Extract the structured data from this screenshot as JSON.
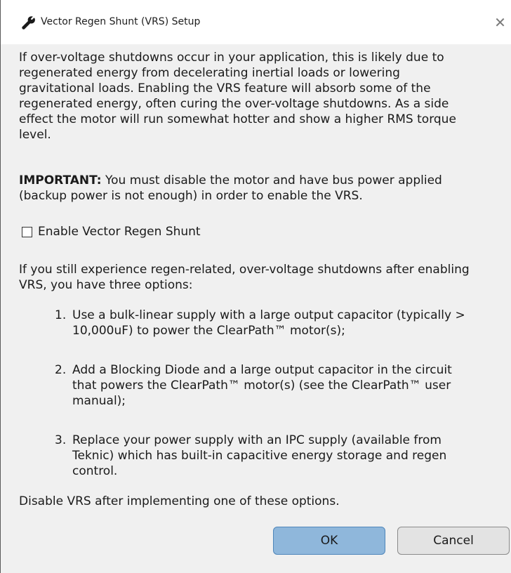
{
  "window": {
    "title": "Vector Regen Shunt (VRS) Setup",
    "title_icon": "wrench-icon",
    "close_glyph": "✕"
  },
  "body": {
    "intro": "If over-voltage shutdowns occur in your application, this is likely due to\nregenerated energy from decelerating inertial loads or lowering\ngravitational loads. Enabling the VRS feature will absorb some of the\nregenerated energy, often curing the over-voltage shutdowns. As a side\neffect the motor will run somewhat hotter and show a higher RMS torque\nlevel.",
    "important_label": "IMPORTANT:",
    "important_text": " You must disable the motor and have bus power applied\n(backup power is not enough) in order to enable the VRS.",
    "checkbox_label": "Enable Vector Regen Shunt",
    "checkbox_checked": false,
    "options_intro": "If you still experience regen-related, over-voltage shutdowns after enabling\nVRS, you have three options:",
    "options": [
      {
        "number": "1.",
        "text": "Use a bulk-linear supply with a large output capacitor (typically >\n10,000uF) to power the ClearPath™ motor(s);"
      },
      {
        "number": "2.",
        "text": "Add a Blocking Diode and a large output capacitor in the circuit\nthat powers the ClearPath™ motor(s) (see the ClearPath™ user\nmanual);"
      },
      {
        "number": "3.",
        "text": "Replace your power supply with an IPC supply (available from\nTeknic) which has built-in capacitive energy storage and regen\ncontrol."
      }
    ],
    "footer_text": "Disable VRS after implementing one of these options."
  },
  "buttons": {
    "ok_label": "OK",
    "cancel_label": "Cancel"
  },
  "colors": {
    "ok_button_bg": "#8fb7db",
    "ok_button_border": "#4f86ba",
    "dialog_bg": "#f0f0f0"
  }
}
